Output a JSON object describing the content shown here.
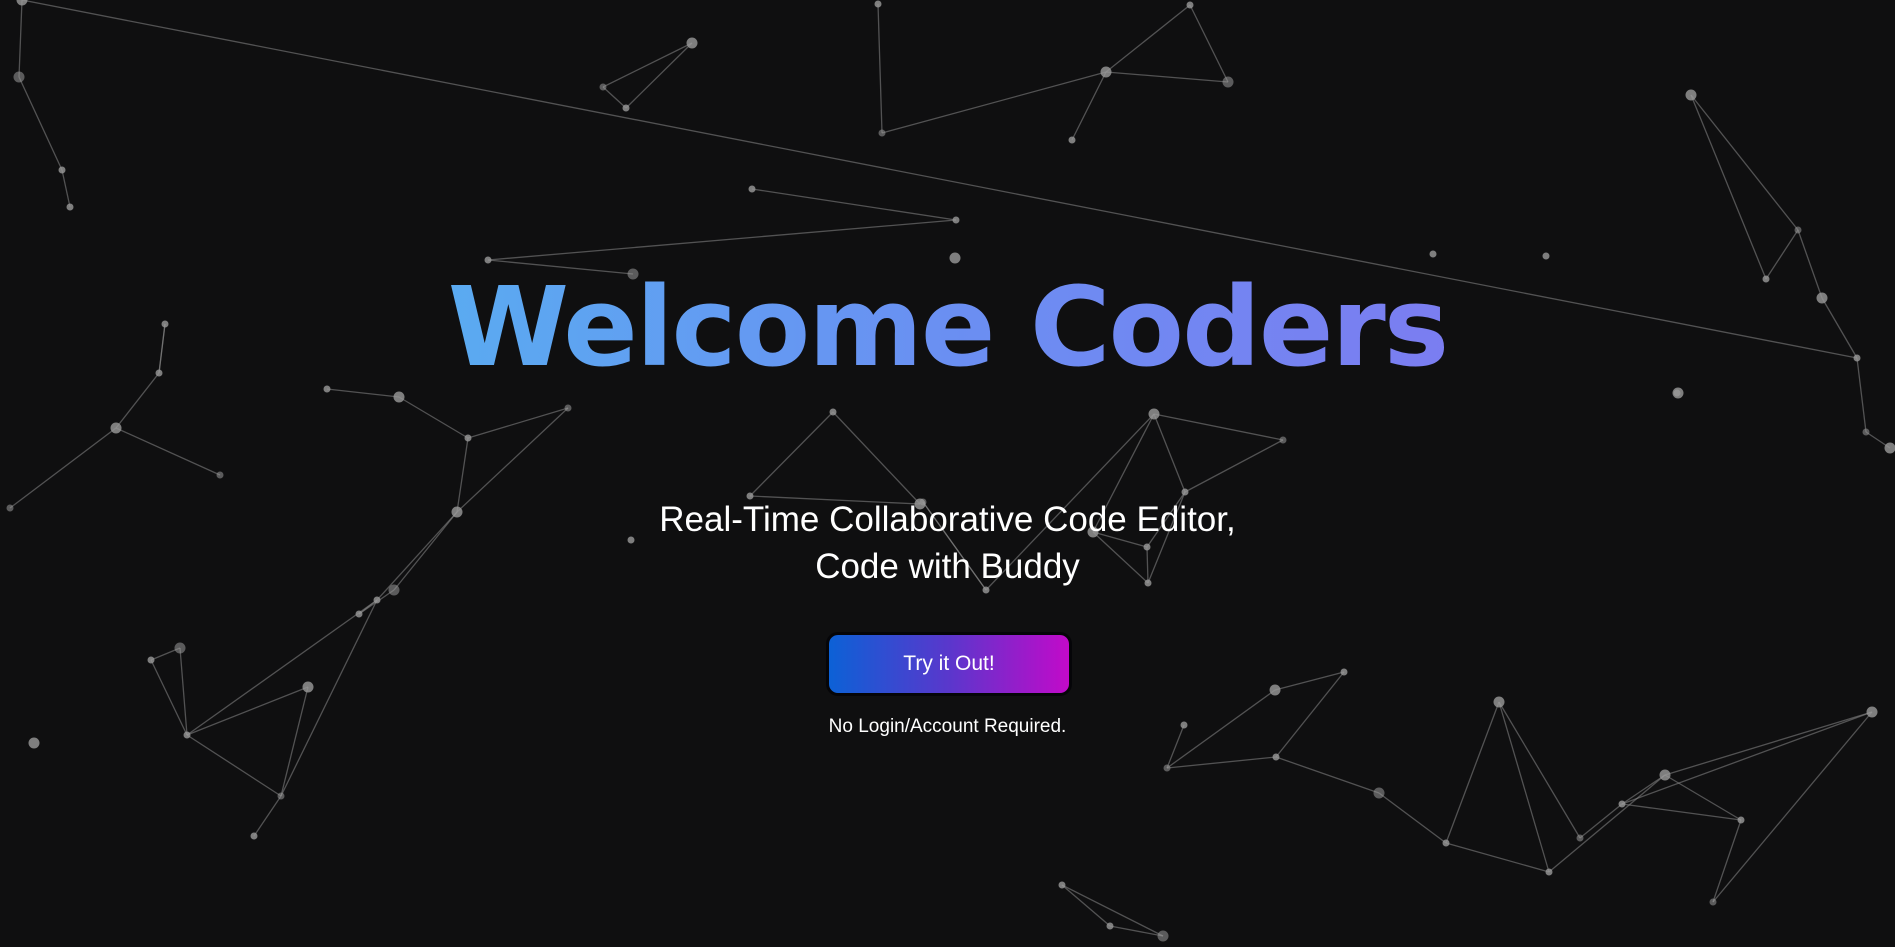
{
  "hero": {
    "title": "Welcome Coders",
    "subtitle_line1": "Real-Time Collaborative Code Editor,",
    "subtitle_line2": "Code with Buddy"
  },
  "cta": {
    "label": "Try it Out!",
    "note": "No Login/Account Required."
  },
  "colors": {
    "background": "#0f0f10",
    "title_gradient_start": "#4cc3f0",
    "title_gradient_end": "#8a6df0",
    "button_gradient_start": "#0c61d6",
    "button_gradient_end": "#c20ac9",
    "particle": "#9a9a9a"
  }
}
